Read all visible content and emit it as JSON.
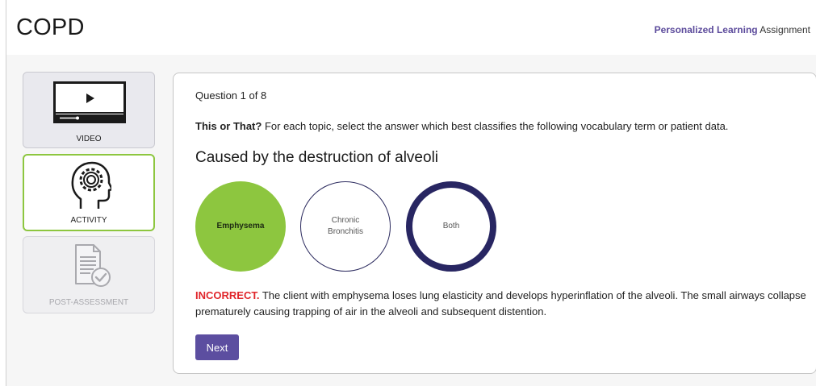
{
  "header": {
    "title": "COPD",
    "assignment_brand": "Personalized Learning",
    "assignment_suffix": "Assignment"
  },
  "sidebar": {
    "items": [
      {
        "label": "VIDEO",
        "icon": "video-player-icon",
        "state": "default"
      },
      {
        "label": "ACTIVITY",
        "icon": "head-gear-icon",
        "state": "active"
      },
      {
        "label": "POST-ASSESSMENT",
        "icon": "document-check-icon",
        "state": "disabled"
      }
    ]
  },
  "question": {
    "counter": "Question 1 of 8",
    "instruction_bold": "This or That?",
    "instruction_rest": " For each topic, select the answer which best classifies the following vocabulary term or patient data.",
    "prompt": "Caused by the destruction of alveoli",
    "choices": [
      {
        "label": "Emphysema",
        "state": "selected"
      },
      {
        "label": "Chronic Bronchitis",
        "state": "unselected"
      },
      {
        "label": "Both",
        "state": "unselected"
      }
    ],
    "feedback_label": "INCORRECT.",
    "feedback_text": " The client with emphysema loses lung elasticity and develops hyperinflation of the alveoli. The small airways collapse prematurely causing trapping of air in the alveoli and subsequent distention.",
    "next_label": "Next"
  },
  "colors": {
    "accent_purple": "#5c4ea0",
    "selected_green": "#8dc63f",
    "incorrect_red": "#e0262b",
    "ring_navy": "#282662"
  }
}
